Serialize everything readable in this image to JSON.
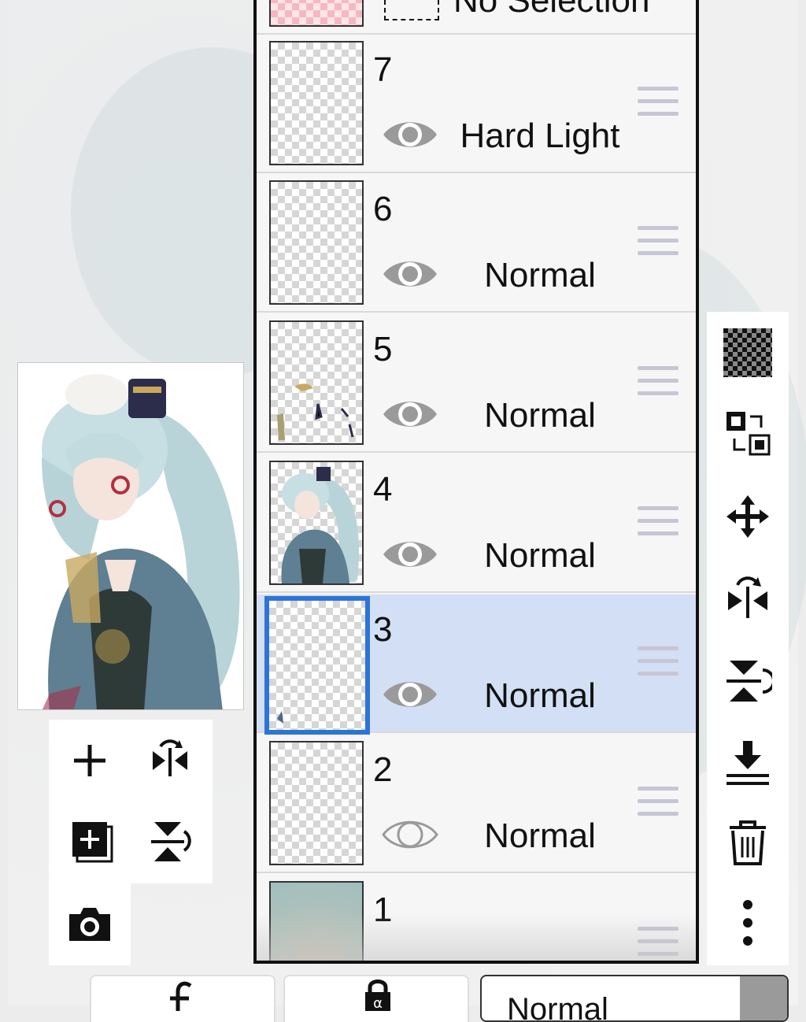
{
  "selection_row": {
    "label": "No Selection"
  },
  "layers": [
    {
      "number": "7",
      "blend": "Hard Light",
      "visible": true,
      "selected": false
    },
    {
      "number": "6",
      "blend": "Normal",
      "visible": true,
      "selected": false
    },
    {
      "number": "5",
      "blend": "Normal",
      "visible": true,
      "selected": false
    },
    {
      "number": "4",
      "blend": "Normal",
      "visible": true,
      "selected": false
    },
    {
      "number": "3",
      "blend": "Normal",
      "visible": true,
      "selected": true
    },
    {
      "number": "2",
      "blend": "Normal",
      "visible": false,
      "selected": false
    },
    {
      "number": "1",
      "blend": "",
      "visible": true,
      "selected": false
    }
  ],
  "left_tools": [
    "add-icon",
    "flip-horizontal-icon",
    "add-layer-icon",
    "flip-vertical-icon",
    "camera-icon"
  ],
  "right_tools": [
    "transparency-icon",
    "swap-layer-icon",
    "move-icon",
    "flip-horizontal-icon",
    "flip-vertical-icon",
    "merge-down-icon",
    "trash-icon",
    "more-icon"
  ],
  "bottom_bar": {
    "clip_icon": "clip-icon",
    "lock_icon": "alpha-lock-icon",
    "blend_mode": "Normal"
  },
  "colors": {
    "selected_row": "#d3dff4",
    "selected_border": "#2e74d6"
  }
}
